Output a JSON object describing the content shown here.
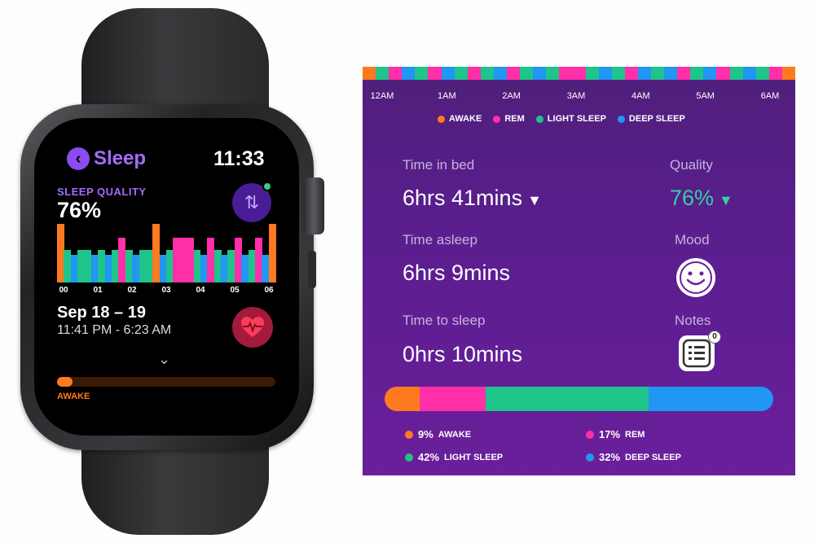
{
  "watch": {
    "app_title": "Sleep",
    "back_glyph": "‹",
    "clock": "11:33",
    "sleep_quality_label": "SLEEP QUALITY",
    "sleep_quality_value": "76%",
    "swap_icon": "swap-arrows-icon",
    "chart_ticks": [
      "00",
      "01",
      "02",
      "03",
      "04",
      "05",
      "06"
    ],
    "date_range": "Sep 18 – 19",
    "time_range": "11:41 PM - 6:23 AM",
    "progress_label": "AWAKE",
    "progress_fraction": 0.07
  },
  "panel": {
    "hours": [
      "12AM",
      "1AM",
      "2AM",
      "3AM",
      "4AM",
      "5AM",
      "6AM"
    ],
    "legend": [
      {
        "label": "AWAKE",
        "color": "#ff7a1f"
      },
      {
        "label": "REM",
        "color": "#ff2fa8"
      },
      {
        "label": "LIGHT SLEEP",
        "color": "#1fc48a"
      },
      {
        "label": "DEEP SLEEP",
        "color": "#2196f3"
      }
    ],
    "time_in_bed_label": "Time in bed",
    "time_in_bed_value": "6hrs 41mins",
    "quality_label": "Quality",
    "quality_value": "76%",
    "time_asleep_label": "Time asleep",
    "time_asleep_value": "6hrs 9mins",
    "mood_label": "Mood",
    "time_to_sleep_label": "Time to sleep",
    "time_to_sleep_value": "0hrs 10mins",
    "notes_label": "Notes",
    "notes_count": "0",
    "distribution": [
      {
        "pct": "9%",
        "label": "AWAKE",
        "value": 9,
        "color": "#ff7a1f"
      },
      {
        "pct": "17%",
        "label": "REM",
        "value": 17,
        "color": "#ff2fa8"
      },
      {
        "pct": "42%",
        "label": "LIGHT SLEEP",
        "value": 42,
        "color": "#1fc48a"
      },
      {
        "pct": "32%",
        "label": "DEEP SLEEP",
        "value": 32,
        "color": "#2196f3"
      }
    ]
  },
  "colors": {
    "awake": "#ff7a1f",
    "rem": "#ff2fa8",
    "light": "#1fc48a",
    "deep": "#2196f3",
    "accent": "#a46bff"
  }
}
